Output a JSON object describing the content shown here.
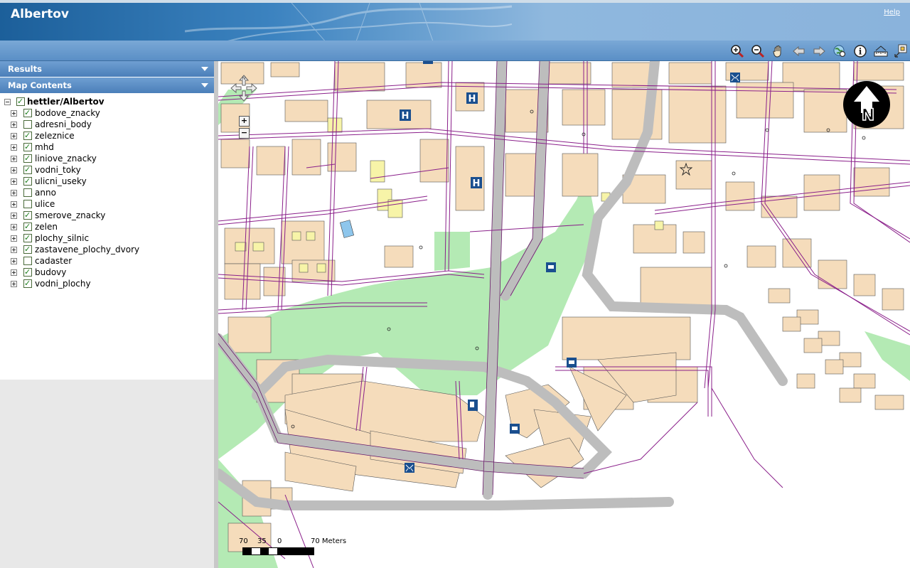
{
  "app": {
    "title": "Albertov",
    "help_label": "Help"
  },
  "toolbar": {
    "tools": [
      "zoom-in-icon",
      "zoom-out-icon",
      "pan-hand-icon",
      "back-arrow-icon",
      "forward-arrow-icon",
      "full-extent-globe-icon",
      "identify-info-icon",
      "measure-ruler-icon",
      "overview-icon"
    ]
  },
  "sidebar": {
    "results_label": "Results",
    "map_contents_label": "Map Contents",
    "root": {
      "label": "hettler/Albertov",
      "checked": true
    },
    "layers": [
      {
        "label": "bodove_znacky",
        "checked": true
      },
      {
        "label": "adresni_body",
        "checked": false
      },
      {
        "label": "zeleznice",
        "checked": true
      },
      {
        "label": "mhd",
        "checked": true
      },
      {
        "label": "liniove_znacky",
        "checked": true
      },
      {
        "label": "vodni_toky",
        "checked": true
      },
      {
        "label": "ulicni_useky",
        "checked": true
      },
      {
        "label": "anno",
        "checked": false
      },
      {
        "label": "ulice",
        "checked": false
      },
      {
        "label": "smerove_znacky",
        "checked": true
      },
      {
        "label": "zelen",
        "checked": true
      },
      {
        "label": "plochy_silnic",
        "checked": true
      },
      {
        "label": "zastavene_plochy_dvory",
        "checked": true
      },
      {
        "label": "cadaster",
        "checked": false
      },
      {
        "label": "budovy",
        "checked": true
      },
      {
        "label": "vodni_plochy",
        "checked": true
      }
    ]
  },
  "map": {
    "zoom_in_label": "+",
    "zoom_out_label": "−",
    "north_label": "N",
    "scale": {
      "labels": [
        "70",
        "35",
        "0",
        "70 Meters"
      ]
    },
    "colors": {
      "building": "#f5dcbb",
      "green": "#b4eab4",
      "road": "#bdbdbd",
      "street_line": "#8a1f8a",
      "water": "#8ec6ec",
      "symbol_blue": "#1a4f8f"
    }
  }
}
